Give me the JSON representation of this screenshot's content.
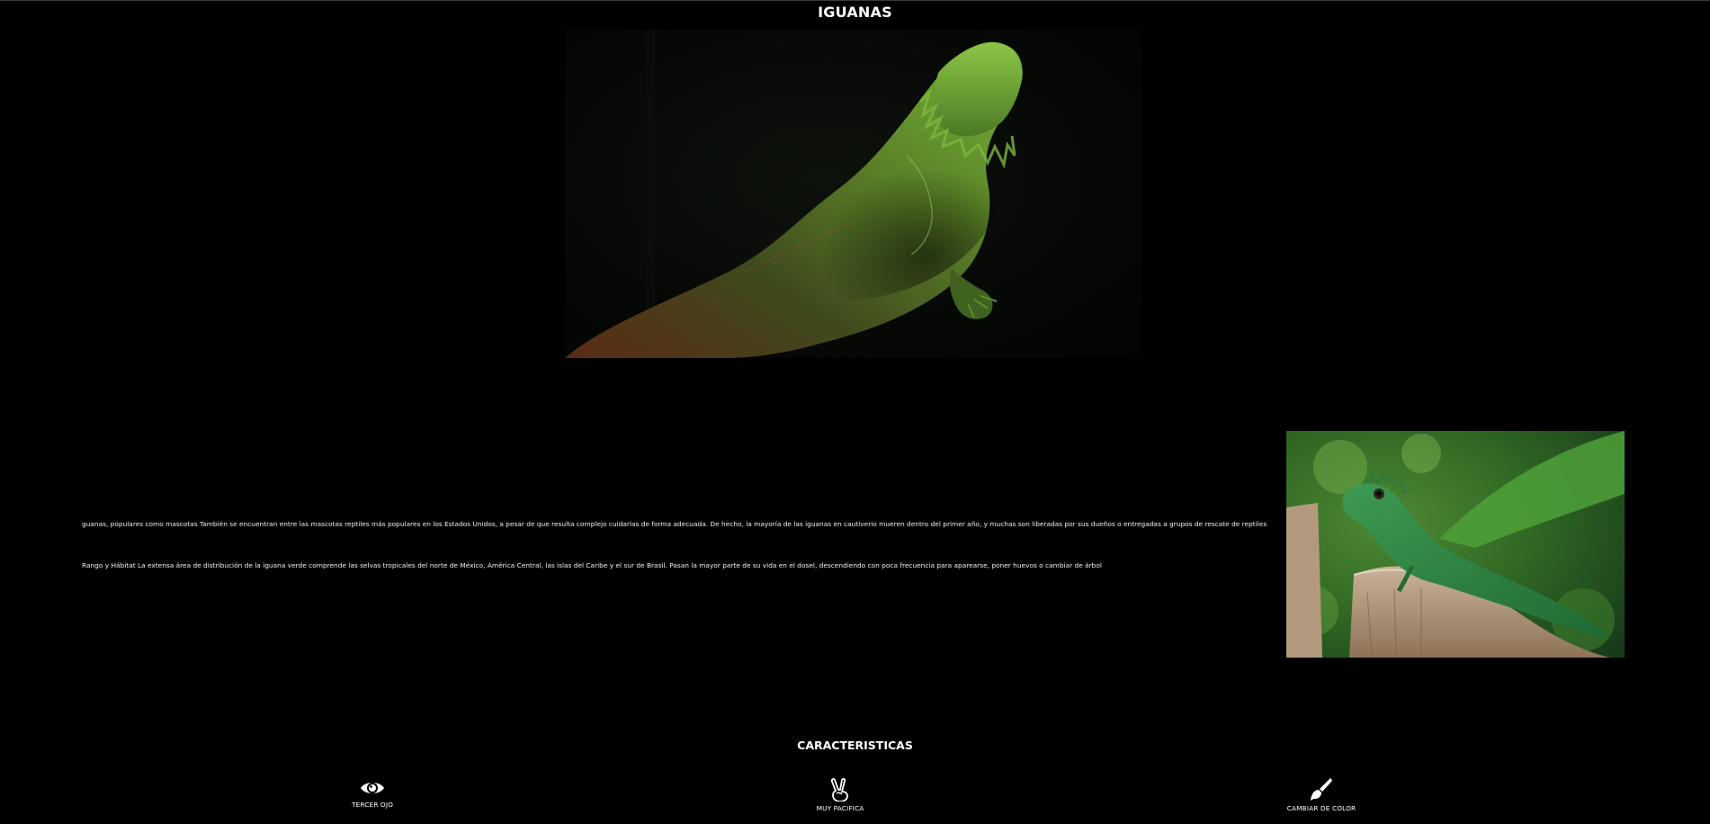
{
  "header": {
    "title": "IGUANAS"
  },
  "content": {
    "paragraph_1": "guanas, populares como mascotas También se encuentran entre las mascotas reptiles más populares en los Estados Unidos, a pesar de que resulta complejo cuidarlas de forma adecuada. De hecho, la mayoría de las iguanas en cautiverio mueren dentro del primer año, y muchas son liberadas por sus dueños o entregadas a grupos de rescate de reptiles",
    "paragraph_2": "Rango y Hábitat La extensa área de distribución de la iguana verde comprende las selvas tropicales del norte de México, América Central, las islas del Caribe y el sur de Brasil. Pasan la mayor parte de su vida en el dosel, descendiendo con poca frecuencia para aparearse, poner huevos o cambiar de árbol"
  },
  "features": {
    "title": "CARACTERISTICAS",
    "items": [
      {
        "label": "TERCER OJO",
        "icon": "eye-icon"
      },
      {
        "label": "MUY PACIFICA",
        "icon": "peace-hand-icon"
      },
      {
        "label": "CAMBIAR DE COLOR",
        "icon": "paintbrush-icon"
      }
    ]
  },
  "colors": {
    "background": "#000000",
    "text": "#ffffff"
  }
}
